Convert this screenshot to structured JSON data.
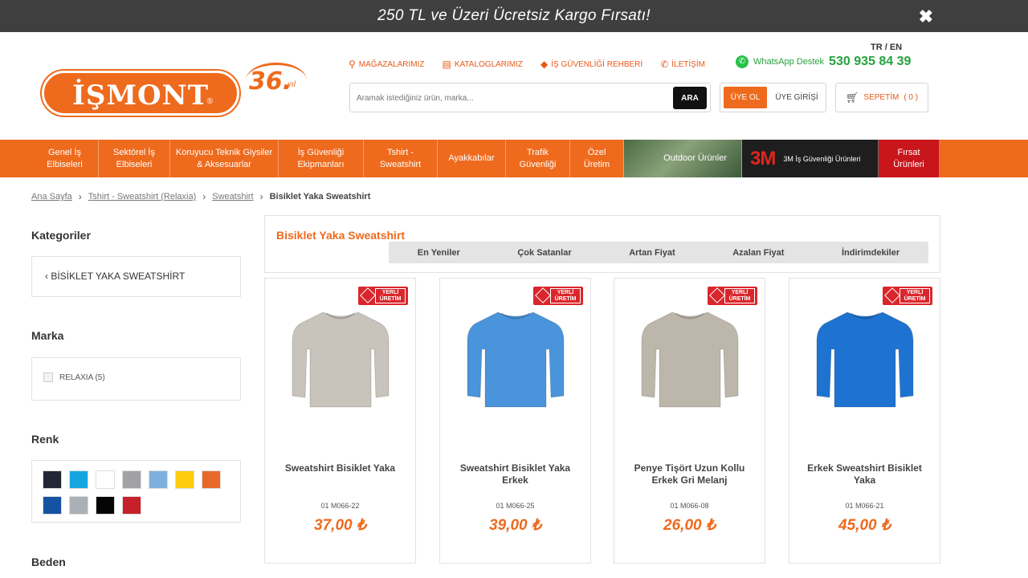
{
  "promo": {
    "text": "250 TL ve Üzeri Ücretsiz Kargo Fırsatı!",
    "close": "✖"
  },
  "logo": {
    "text": "İŞMONT",
    "reg": "®",
    "years_num": "36.",
    "years_suffix": "yıl"
  },
  "lang": "TR / EN",
  "topnav": [
    {
      "label": "MAĞAZALARIMIZ",
      "icon": "map-pin-icon"
    },
    {
      "label": "KATALOGLARIMIZ",
      "icon": "book-icon"
    },
    {
      "label": "İŞ GÜVENLİĞİ REHBERİ",
      "icon": "tag-icon"
    },
    {
      "label": "İLETİŞİM",
      "icon": "phone-icon"
    }
  ],
  "whatsapp": {
    "label": "WhatsApp Destek",
    "phone": "530 935 84 39"
  },
  "search": {
    "placeholder": "Aramak istediğiniz ürün, marka...",
    "button": "ARA"
  },
  "auth": {
    "register": "ÜYE OL",
    "login": "ÜYE GİRİŞİ"
  },
  "cart": {
    "label": "SEPETİM",
    "count": "( 0 )"
  },
  "categories": [
    "Genel İş Elbiseleri",
    "Sektörel İş Elbiseleri",
    "Koruyucu Teknik Giysiler & Aksesuarlar",
    "İş Güvenliği Ekipmanları",
    "Tshirt - Sweatshirt",
    "Ayakkabılar",
    "Trafik Güvenliği",
    "Özel Üretim"
  ],
  "category_banners": {
    "outdoor": "Outdoor Ürünler",
    "three_m_logo": "3M",
    "three_m": "3M İş Güvenliği Ürünleri",
    "firsat": "Fırsat Ürünleri"
  },
  "breadcrumb": {
    "links": [
      "Ana Sayfa",
      "Tshirt - Sweatshirt (Relaxia)",
      "Sweatshirt"
    ],
    "current": "Bisiklet Yaka Sweatshirt",
    "separator": "›"
  },
  "sidebar": {
    "categories_title": "Kategoriler",
    "category_item": "‹  BİSİKLET YAKA SWEATSHİRT",
    "brand_title": "Marka",
    "brand_item": "RELAXIA (5)",
    "color_title": "Renk",
    "colors": [
      "#232635",
      "#16a6df",
      "#ffffff",
      "#a3a1a6",
      "#7fb0dd",
      "#ffcb0d",
      "#e8682a",
      "#1552a4",
      "#aab0b5",
      "#050505",
      "#c6202a"
    ],
    "size_title": "Beden"
  },
  "list": {
    "title": "Bisiklet Yaka Sweatshirt",
    "sort": [
      "En Yeniler",
      "Çok Satanlar",
      "Artan Fiyat",
      "Azalan Fiyat",
      "İndirimdekiler"
    ]
  },
  "badge": "YERLİ ÜRETİM",
  "products": [
    {
      "name": "Sweatshirt Bisiklet Yaka",
      "code": "01 M066-22",
      "price": "37,00 ₺",
      "color": "#c8c3bb"
    },
    {
      "name": "Sweatshirt Bisiklet Yaka Erkek",
      "code": "01 M066-25",
      "price": "39,00 ₺",
      "color": "#4a94db"
    },
    {
      "name": "Penye Tişört Uzun Kollu Erkek Gri Melanj",
      "code": "01 M066-08",
      "price": "26,00 ₺",
      "color": "#bdb7ab"
    },
    {
      "name": "Erkek Sweatshirt Bisiklet Yaka",
      "code": "01 M066-21",
      "price": "45,00 ₺",
      "color": "#1f73d0"
    }
  ]
}
